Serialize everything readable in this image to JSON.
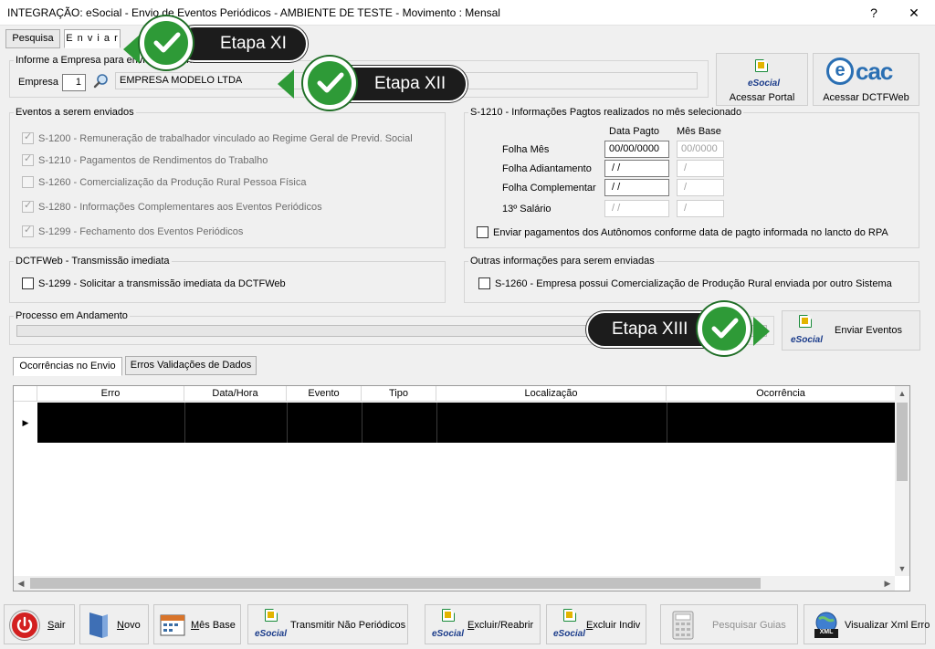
{
  "window": {
    "title": "INTEGRAÇÃO: eSocial - Envio de Eventos Periódicos - AMBIENTE DE TESTE - Movimento : Mensal",
    "help": "?",
    "close": "✕"
  },
  "tabs": {
    "pesquisa": "Pesquisa",
    "enviar": "E n v i a r"
  },
  "empresa": {
    "legend": "Informe a Empresa para enviar os eventos ao eSocial:",
    "label": "Empresa",
    "code": "1",
    "name": "EMPRESA MODELO LTDA"
  },
  "portal": {
    "logo": "eSocial",
    "label": "Acessar Portal"
  },
  "dctf": {
    "logo_e": "e",
    "logo_cac": "cac",
    "label": "Acessar DCTFWeb"
  },
  "eventos": {
    "legend": "Eventos a serem enviados",
    "items": [
      {
        "label": "S-1200 - Remuneração de trabalhador vinculado ao Regime Geral de Previd. Social",
        "checked": true
      },
      {
        "label": "S-1210 - Pagamentos de Rendimentos do Trabalho",
        "checked": true
      },
      {
        "label": "S-1260 - Comercialização da Produção Rural Pessoa Física",
        "checked": false
      },
      {
        "label": "S-1280 - Informações Complementares aos Eventos Periódicos",
        "checked": true
      },
      {
        "label": "S-1299 - Fechamento dos Eventos Periódicos",
        "checked": true
      }
    ]
  },
  "s1210": {
    "legend": "S-1210 - Informações Pagtos realizados no mês selecionado",
    "col_data": "Data Pagto",
    "col_mes": "Mês Base",
    "rows": [
      {
        "label": "Folha Mês",
        "data": "00/00/0000",
        "mes": "00/0000"
      },
      {
        "label": "Folha Adiantamento",
        "data": " / /",
        "mes": " /"
      },
      {
        "label": "Folha Complementar",
        "data": " / /",
        "mes": " /"
      },
      {
        "label": "13º Salário",
        "data": " / /",
        "mes": " /"
      }
    ],
    "autonomos": "Enviar pagamentos dos Autônomos conforme data de pagto informada no lancto do RPA"
  },
  "dctfweb": {
    "legend": "DCTFWeb - Transmissão imediata",
    "item": "S-1299 - Solicitar a transmissão imediata da DCTFWeb"
  },
  "outras": {
    "legend": "Outras informações para serem enviadas",
    "item": "S-1260 - Empresa possui Comercialização de Produção Rural enviada por outro Sistema"
  },
  "processo": {
    "label": "Processo em Andamento",
    "progress": 0
  },
  "enviar_eventos": {
    "logo": "eSocial",
    "label": "Enviar Eventos"
  },
  "callouts": {
    "c1": "Etapa XI",
    "c2": "Etapa XII",
    "c3": "Etapa XIII"
  },
  "result_tabs": {
    "ocorrencias": "Ocorrências no Envio",
    "erros": "Erros Validações de Dados"
  },
  "grid": {
    "columns": [
      "Erro",
      "Data/Hora",
      "Evento",
      "Tipo",
      "Localização",
      "Ocorrência"
    ],
    "row_marker": "▶"
  },
  "toolbar": {
    "sair_k": "S",
    "sair_rest": "air",
    "novo_k": "N",
    "novo_rest": "ovo",
    "mes_k": "M",
    "mes_rest": "ês Base",
    "transmitir": "Transmitir Não Periódicos",
    "excluir_k": "E",
    "excluir_rest": "xcluir/Reabrir",
    "excluir_indiv_k": "E",
    "excluir_indiv_rest": "xcluir Indiv",
    "pesquisar": "Pesquisar Guias",
    "xml": "Visualizar Xml Erro",
    "xml_icon": "XML",
    "esocial": "eSocial"
  },
  "colors": {
    "accent_green": "#2e9a37",
    "callout_bg": "#1c1c1c",
    "grid_selected": "#000000"
  }
}
